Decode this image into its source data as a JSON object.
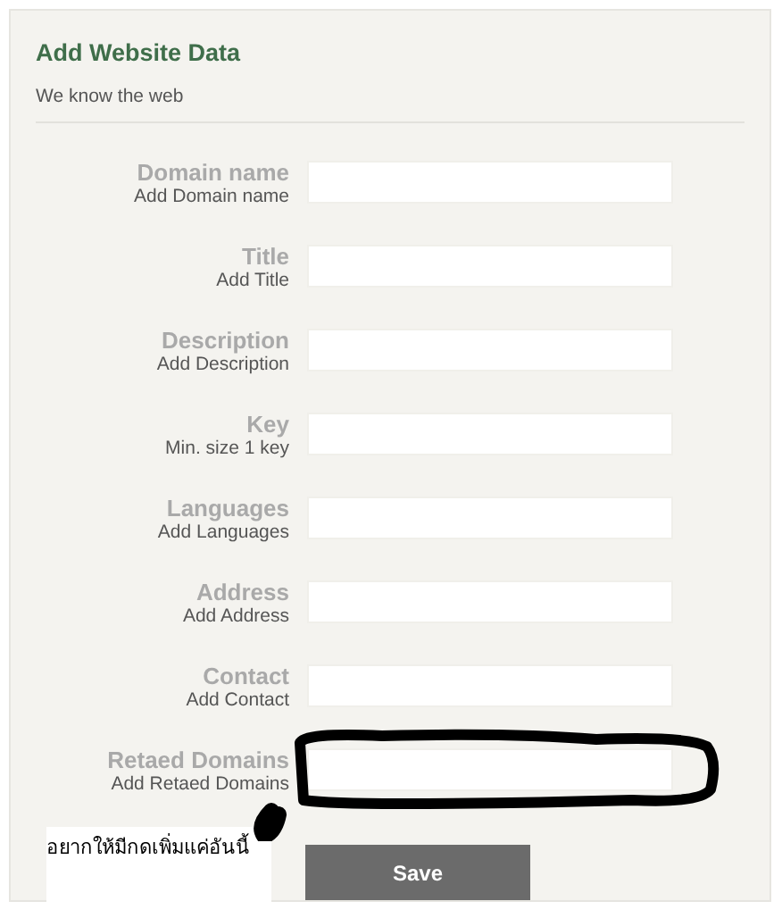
{
  "header": {
    "title": "Add Website Data",
    "subtitle": "We know the web"
  },
  "fields": [
    {
      "label": "Domain name",
      "hint": "Add Domain name"
    },
    {
      "label": "Title",
      "hint": "Add Title"
    },
    {
      "label": "Description",
      "hint": "Add Description"
    },
    {
      "label": "Key",
      "hint": "Min. size 1 key"
    },
    {
      "label": "Languages",
      "hint": "Add Languages"
    },
    {
      "label": "Address",
      "hint": "Add Address"
    },
    {
      "label": "Contact",
      "hint": "Add Contact"
    },
    {
      "label": "Retaed Domains",
      "hint": "Add Retaed Domains"
    }
  ],
  "note": "อยากให้มีกดเพิ่มแค่อันนี้",
  "save_button": "Save"
}
